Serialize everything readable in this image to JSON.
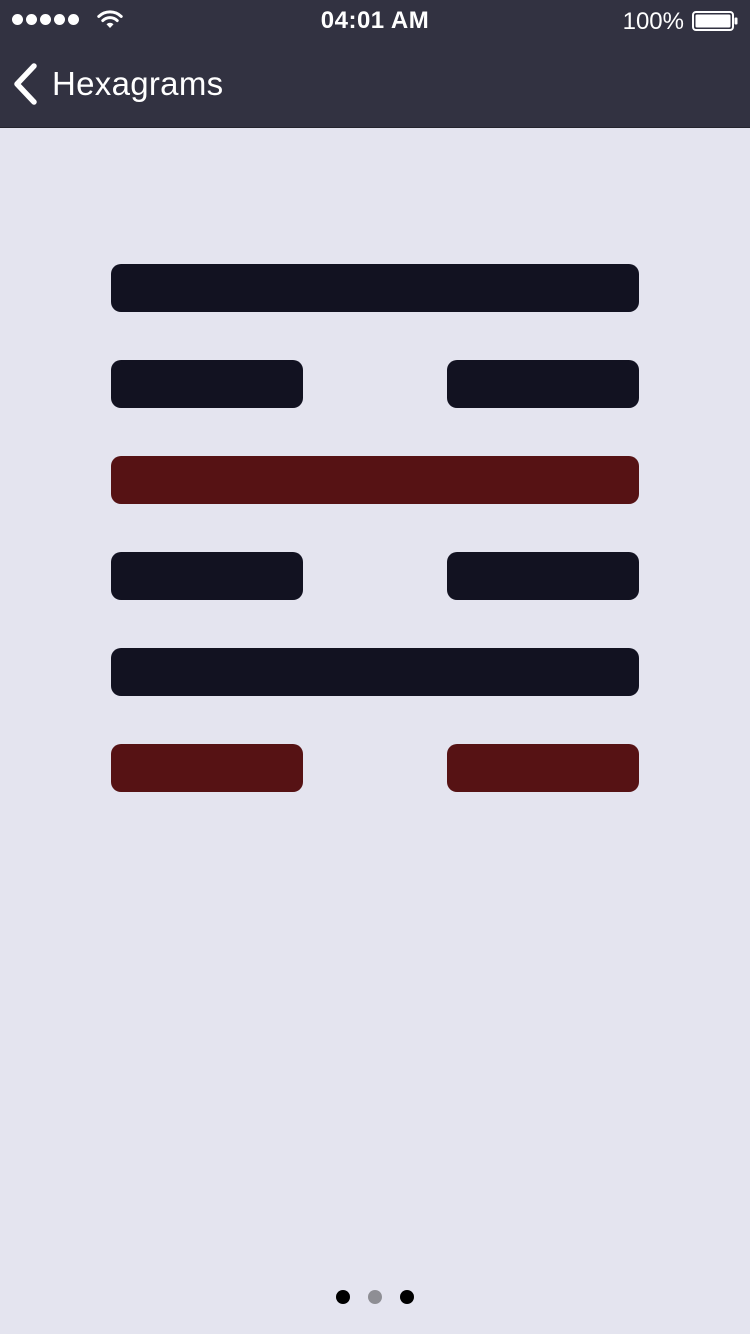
{
  "status_bar": {
    "time": "04:01 AM",
    "battery_percent": "100%",
    "signal_bars": 5,
    "icons": [
      "signal-dots-icon",
      "wifi-icon",
      "battery-icon"
    ]
  },
  "nav": {
    "back_label": "Hexagrams",
    "back_icon": "chevron-left-icon"
  },
  "colors": {
    "top_bar": "#323241",
    "background": "#e4e4ef",
    "line_normal": "#121221",
    "line_changing": "#561214",
    "pager_active": "#000000",
    "pager_inactive": "#8e8e94"
  },
  "hexagram": {
    "lines_top_to_bottom": [
      {
        "type": "solid",
        "changing": false
      },
      {
        "type": "broken",
        "changing": false
      },
      {
        "type": "solid",
        "changing": true
      },
      {
        "type": "broken",
        "changing": false
      },
      {
        "type": "solid",
        "changing": false
      },
      {
        "type": "broken",
        "changing": true
      }
    ]
  },
  "pager": {
    "count": 3,
    "current_index": 1
  }
}
